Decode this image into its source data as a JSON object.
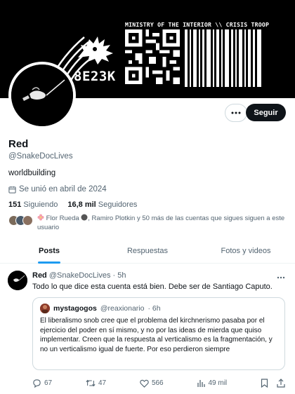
{
  "banner": {
    "ministry_text": "MINISTRY OF THE INTERIOR \\\\ CRISIS TROOP",
    "code_text": "8E23K"
  },
  "profile": {
    "name": "Red",
    "handle": "@SnakeDocLives",
    "bio": "worldbuilding",
    "joined": "Se unió en abril de 2024",
    "following_count": "151",
    "following_label": "Siguiendo",
    "followers_count": "16,8 mil",
    "followers_label": "Seguidores",
    "followers_you_know": "Flor Rueda, Ramiro Plotkin y 50 más de las cuentas que sigues siguen a este usuario",
    "fyk_flor": "Flor Rueda",
    "fyk_rest": ", Ramiro Plotkin y 50 más de las cuentas que sigues siguen a este usuario"
  },
  "buttons": {
    "follow": "Seguir"
  },
  "tabs": [
    {
      "label": "Posts",
      "active": true
    },
    {
      "label": "Respuestas",
      "active": false
    },
    {
      "label": "Fotos y videos",
      "active": false
    }
  ],
  "tweet": {
    "author": "Red",
    "handle": "@SnakeDocLives",
    "time": "· 5h",
    "text": "Todo lo que dice esta cuenta está bien. Debe ser de Santiago Caputo.",
    "quote": {
      "author": "mystagogos",
      "handle": "@reaxionario",
      "time": "· 6h",
      "text": "El liberalismo snob cree que el problema del kirchnerismo pasaba por el ejercicio del poder en sí mismo, y no por las ideas de mierda que quiso implementar. Creen que la respuesta al verticalismo es la fragmentación, y no un verticalismo igual de fuerte. Por eso perdieron siempre"
    },
    "replies": "67",
    "reposts": "47",
    "likes": "566",
    "views": "49 mil"
  },
  "colors": {
    "accent": "#1d9bf0",
    "text_primary": "#0f1419",
    "text_secondary": "#536471",
    "border": "#cfd9de"
  },
  "icons": [
    "more-icon",
    "calendar-icon",
    "reply-icon",
    "repost-icon",
    "like-icon",
    "views-icon",
    "bookmark-icon",
    "share-icon",
    "flower-icon"
  ]
}
